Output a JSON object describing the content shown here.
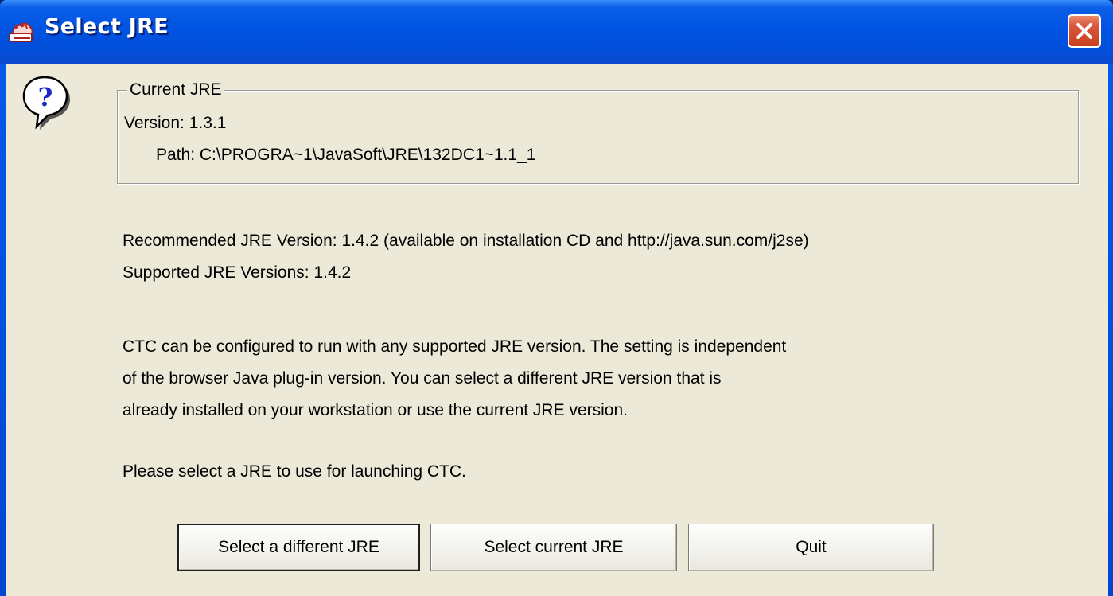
{
  "window": {
    "title": "Select JRE",
    "close_icon": "close-icon"
  },
  "icons": {
    "app": "java-app-icon",
    "question": "question-icon"
  },
  "current_jre": {
    "group_title": "Current JRE",
    "version_label": "Version:",
    "version_value": "1.3.1",
    "path_label": "Path:",
    "path_value": "C:\\PROGRA~1\\JavaSoft\\JRE\\132DC1~1.1_1"
  },
  "info": {
    "recommended_label": "Recommended JRE Version:",
    "recommended_value": "1.4.2 (available on installation CD and http://java.sun.com/j2se)",
    "supported_label": "Supported JRE Versions:",
    "supported_value": "1.4.2"
  },
  "description": [
    "CTC can be configured to run with any supported JRE version.  The setting is independent",
    "of the browser Java plug-in version.  You can select a different JRE version that is",
    "already installed on your workstation or use the current JRE version."
  ],
  "prompt": "Please select a JRE to use for launching CTC.",
  "buttons": {
    "select_different": "Select a different JRE",
    "select_current": "Select current JRE",
    "quit": "Quit"
  },
  "colors": {
    "titlebar": "#0054e3",
    "client_background": "#ece9d8",
    "close_button": "#d9553a"
  }
}
